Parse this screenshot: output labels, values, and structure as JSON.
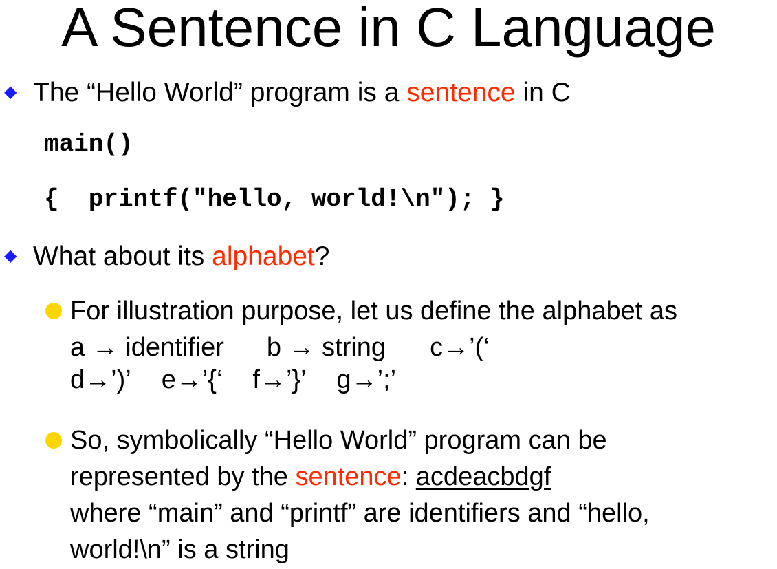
{
  "slide": {
    "title": "A Sentence in C Language",
    "bullet1": {
      "pre": "The “Hello World” program is a ",
      "highlight": "sentence",
      "post": " in C"
    },
    "code_line1": "main()",
    "code_line2": "{  printf(\"hello, world!\\n\"); }",
    "bullet2": {
      "pre": "What about its ",
      "highlight": "alphabet",
      "post": "?"
    },
    "sub1": {
      "line1": "For illustration purpose, let us define the alphabet as",
      "a": "a → identifier",
      "b": "b → string",
      "c": "c→’(‘",
      "d": "d→’)’",
      "e": "e→’{‘",
      "f": "f→’}’",
      "g": "g→’;’"
    },
    "sub2": {
      "line1": "So, symbolically “Hello World” program can be",
      "line2_pre": "represented by the ",
      "line2_highlight": "sentence",
      "line2_colon": ": ",
      "line2_value": "acdeacbdgf",
      "line3": "where “main” and “printf” are identifiers and “hello,",
      "line4": "world!\\n” is a string"
    },
    "colors": {
      "bullet_diamond": "#1a1aff",
      "highlight": "#ff2a00",
      "sub_bullet_dot": "#ffd500"
    },
    "icons": {
      "bullet": "diamond-bullet-icon",
      "sub_bullet": "yellow-dot-bullet-icon"
    }
  }
}
